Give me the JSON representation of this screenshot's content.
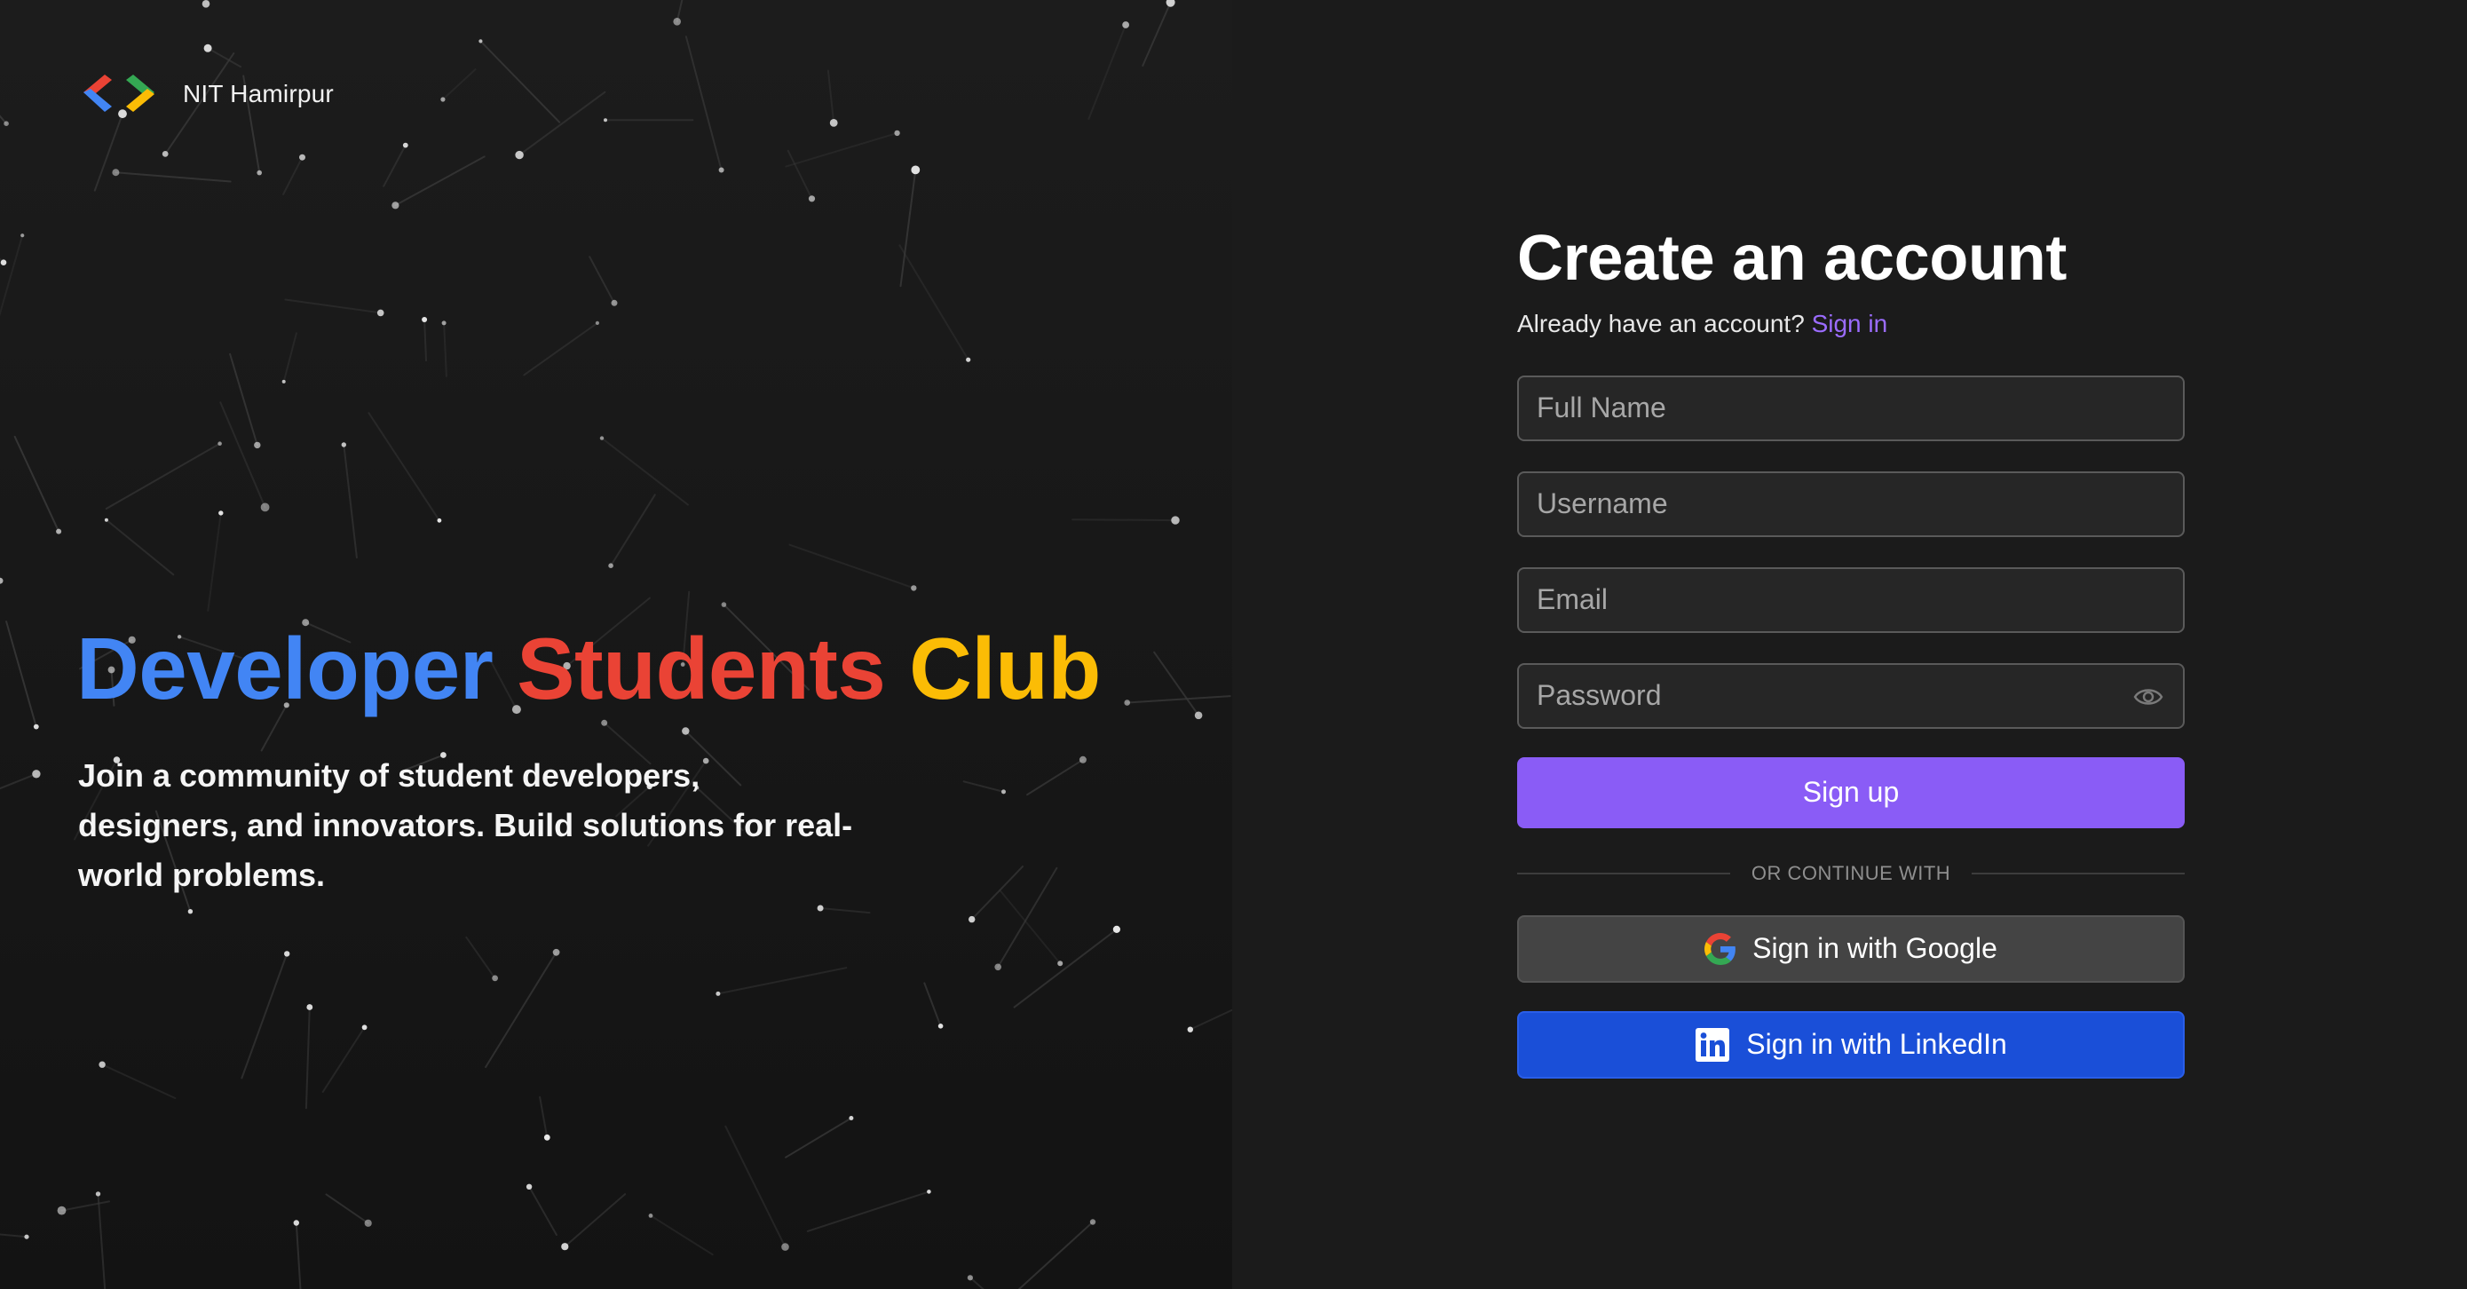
{
  "brand": {
    "name": "NIT Hamirpur",
    "logo_icon": "gdsc-chevrons-icon"
  },
  "hero": {
    "title_word1": "Developer",
    "title_word2": "Students",
    "title_word3": "Club",
    "subtitle": "Join a community of student developers, designers, and innovators. Build solutions for real-world problems."
  },
  "form": {
    "title": "Create an account",
    "already_text": "Already have an account?",
    "signin_link": "Sign in",
    "fullname_placeholder": "Full Name",
    "username_placeholder": "Username",
    "email_placeholder": "Email",
    "password_placeholder": "Password",
    "password_toggle_icon": "eye-icon",
    "signup_label": "Sign up",
    "divider_text": "OR CONTINUE WITH",
    "google_label": "Sign in with Google",
    "linkedin_label": "Sign in with LinkedIn"
  },
  "colors": {
    "blue": "#4285f4",
    "red": "#ea4335",
    "yellow": "#fbbc05",
    "green": "#34a853",
    "accent": "#8a5cf6",
    "link": "#9b6cff",
    "linkedin": "#1a4fd8",
    "background": "#1b1b1b"
  }
}
